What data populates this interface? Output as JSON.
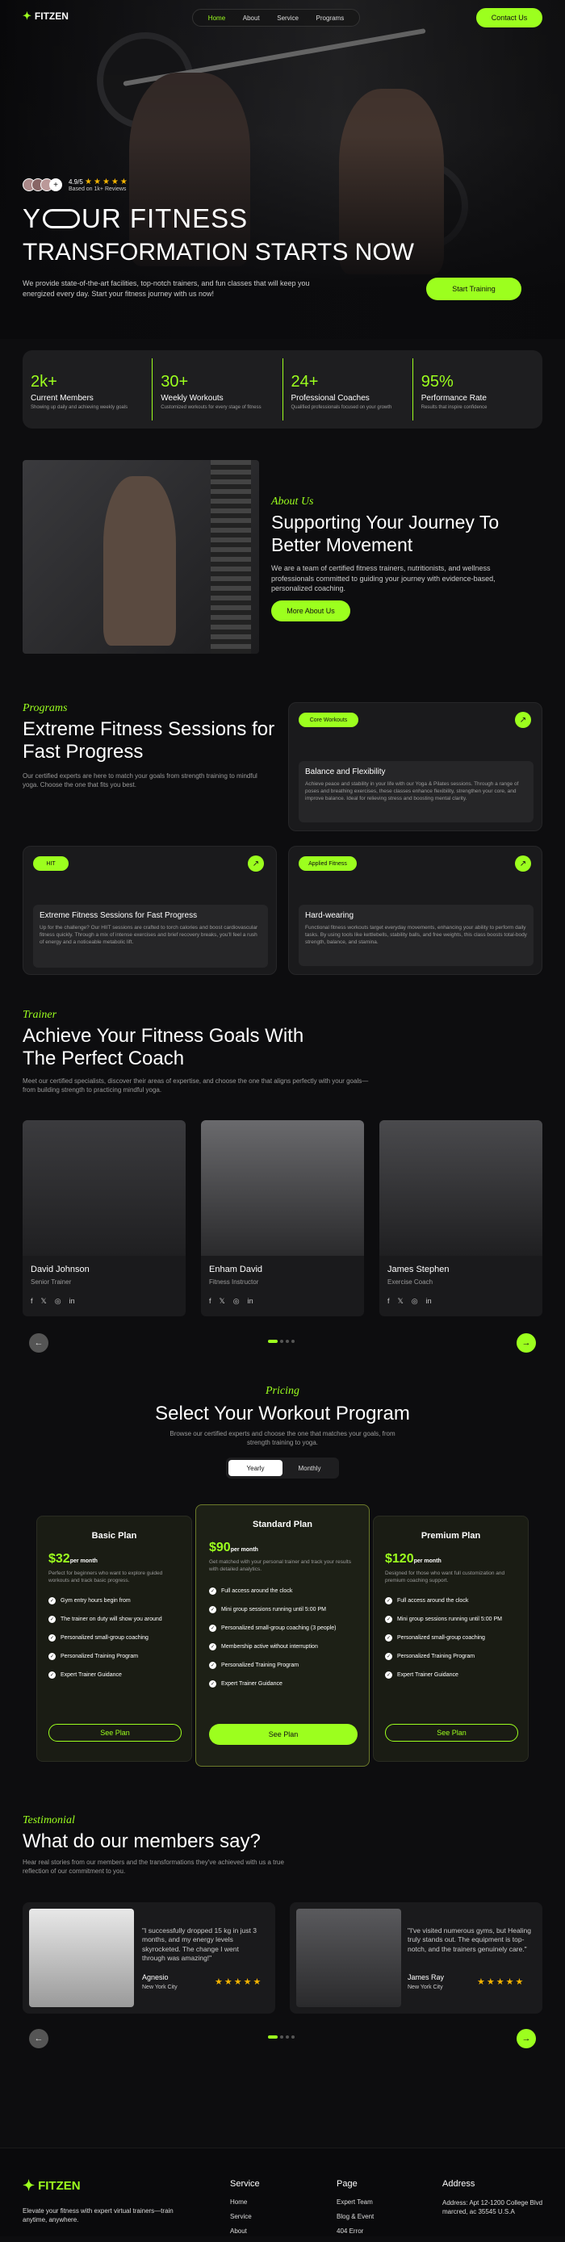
{
  "brand": {
    "name": "FITZEN",
    "accent": "#9cff1e"
  },
  "nav": {
    "items": [
      "Home",
      "About",
      "Service",
      "Programs"
    ],
    "contact": "Contact Us"
  },
  "hero": {
    "rating": "4.9/5",
    "reviews": "Based on 1k+ Reviews",
    "title1": "Y",
    "title1b": "UR FITNESS",
    "title2": "TRANSFORMATION STARTS NOW",
    "desc": "We provide state-of-the-art facilities, top-notch trainers, and fun classes that will keep you energized every day. Start your fitness journey with us now!",
    "cta": "Start Training"
  },
  "stats": [
    {
      "n": "2k+",
      "l": "Current Members",
      "d": "Showing up daily and achieving weekly goals"
    },
    {
      "n": "30+",
      "l": "Weekly Workouts",
      "d": "Customized workouts for every stage of fitness"
    },
    {
      "n": "24+",
      "l": "Professional Coaches",
      "d": "Qualified professionals focused on your growth"
    },
    {
      "n": "95%",
      "l": "Performance Rate",
      "d": "Results that inspire confidence"
    }
  ],
  "about": {
    "kicker": "About Us",
    "title": "Supporting Your Journey To Better Movement",
    "desc": "We are a team of certified fitness trainers, nutritionists, and wellness professionals committed to guiding your journey with evidence-based, personalized coaching.",
    "cta": "More About Us"
  },
  "programs": {
    "kicker": "Programs",
    "title": "Extreme Fitness Sessions for Fast Progress",
    "desc": "Our certified experts are here to match your goals from strength training to mindful yoga. Choose the one that fits you best.",
    "cards": [
      {
        "tag": "Core Workouts",
        "title": "Balance and Flexibility",
        "desc": "Achieve peace and stability in your life with our Yoga & Pilates sessions. Through a range of poses and breathing exercises, these classes enhance flexibility, strengthen your core, and improve balance. Ideal for relieving stress and boosting mental clarity."
      },
      {
        "tag": "HIT",
        "title": "Extreme Fitness Sessions for Fast Progress",
        "desc": "Up for the challenge? Our HIIT sessions are crafted to torch calories and boost cardiovascular fitness quickly. Through a mix of intense exercises and brief recovery breaks, you'll feel a rush of energy and a noticeable metabolic lift."
      },
      {
        "tag": "Applied Fitness",
        "title": "Hard-wearing",
        "desc": "Functional fitness workouts target everyday movements, enhancing your ability to perform daily tasks. By using tools like kettlebells, stability balls, and free weights, this class boosts total-body strength, balance, and stamina."
      }
    ]
  },
  "trainer": {
    "kicker": "Trainer",
    "title": "Achieve Your Fitness Goals With The Perfect Coach",
    "desc": "Meet our certified specialists, discover their areas of expertise, and choose the one that aligns perfectly with your goals—from building strength to practicing mindful yoga.",
    "coaches": [
      {
        "name": "David Johnson",
        "role": "Senior Trainer"
      },
      {
        "name": "Enham David",
        "role": "Fitness Instructor"
      },
      {
        "name": "James Stephen",
        "role": "Exercise Coach"
      }
    ]
  },
  "pricing": {
    "kicker": "Pricing",
    "title": "Select Your Workout Program",
    "desc": "Browse our certified experts and choose the one that matches your goals, from strength training to yoga.",
    "toggle": [
      "Yearly",
      "Monthly"
    ],
    "per": "per month",
    "plans": [
      {
        "name": "Basic Plan",
        "price": "$32",
        "desc": "Perfect for beginners who want to explore guided workouts and track basic progress.",
        "features": [
          "Gym entry hours begin from",
          "The trainer on duty will show you around",
          "Personalized small-group coaching",
          "Personalized Training Program",
          "Expert Trainer Guidance"
        ],
        "cta": "See Plan"
      },
      {
        "name": "Standard Plan",
        "price": "$90",
        "desc": "Get matched with your personal trainer and track your results with detailed analytics.",
        "features": [
          "Full access around the clock",
          "Mini group sessions running until 5:00 PM",
          "Personalized small-group coaching (3 people)",
          "Membership active without interruption",
          "Personalized Training Program",
          "Expert Trainer Guidance"
        ],
        "cta": "See Plan"
      },
      {
        "name": "Premium Plan",
        "price": "$120",
        "desc": "Designed for those who want full customization and premium coaching support.",
        "features": [
          "Full access around the clock",
          "Mini group sessions running until 5:00 PM",
          "Personalized small-group coaching",
          "Personalized Training Program",
          "Expert Trainer Guidance"
        ],
        "cta": "See Plan"
      }
    ]
  },
  "testimonial": {
    "kicker": "Testimonial",
    "title": "What do our members say?",
    "desc": "Hear real stories from our members and the transformations they've achieved with us a true reflection of our commitment to you.",
    "items": [
      {
        "quote": "\"I successfully dropped 15 kg in just 3 months, and my energy levels skyrocketed. The change I went through was amazing!\"",
        "name": "Agnesio",
        "loc": "New York City"
      },
      {
        "quote": "\"I've visited numerous gyms, but Healing truly stands out. The equipment is top-notch, and the trainers genuinely care.\"",
        "name": "James Ray",
        "loc": "New York City"
      }
    ]
  },
  "footer": {
    "tagline": "Elevate your fitness with expert virtual trainers—train anytime, anywhere.",
    "service": {
      "h": "Service",
      "items": [
        "Home",
        "Service",
        "About"
      ]
    },
    "page": {
      "h": "Page",
      "items": [
        "Expert Team",
        "Blog & Event",
        "404 Error"
      ]
    },
    "address": {
      "h": "Address",
      "text": "Address: Apt 12-1200 College Blvd marcred, ac 35545 U.S.A"
    }
  }
}
